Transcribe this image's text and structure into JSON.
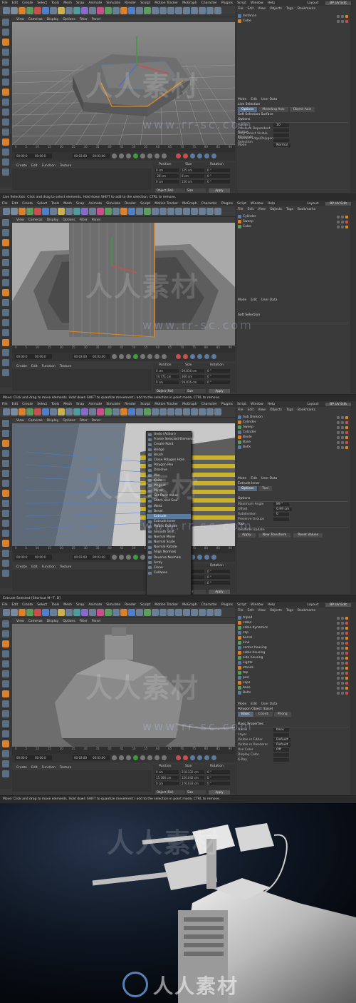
{
  "menu": [
    "File",
    "Edit",
    "Create",
    "Select",
    "Tools",
    "Mesh",
    "Snap",
    "Animate",
    "Simulate",
    "Render",
    "Sculpt",
    "Motion Tracker",
    "MoGraph",
    "Character",
    "Plugins",
    "Script",
    "Window",
    "Help"
  ],
  "layout": {
    "label": "Layout:",
    "value": "BP UV Edit"
  },
  "viewport_menu": [
    "View",
    "Cameras",
    "Display",
    "Options",
    "Filter",
    "Panel"
  ],
  "object_menu": [
    "File",
    "Edit",
    "View",
    "Objects",
    "Tags",
    "Bookmarks"
  ],
  "attr_menu": [
    "Mode",
    "Edit",
    "User Data"
  ],
  "material_menu": [
    "Create",
    "Edit",
    "Function",
    "Texture"
  ],
  "coords": {
    "position": "Position",
    "size": "Size",
    "rotation": "Rotation",
    "object_rel": "Object (Rel)",
    "size_sel": "Size",
    "apply": "Apply"
  },
  "timeline": [
    "0",
    "5",
    "10",
    "15",
    "20",
    "25",
    "30",
    "35",
    "40",
    "45",
    "50",
    "55",
    "60",
    "65",
    "70",
    "75",
    "80",
    "85",
    "90"
  ],
  "fields": {
    "start": "00:00:0",
    "cur": "00:00:0",
    "end": "00:03:00",
    "end2": "00:03:00"
  },
  "panels": [
    {
      "status": "Live Selection: Click and drag to select elements. Hold down SHIFT to add to the selection, CTRL to remove.",
      "objects": [
        "Instance",
        "Cube"
      ],
      "attr_title": "Live Selection",
      "tabs": [
        "Options",
        "Modeling Axis",
        "Object Axis"
      ],
      "sub": "Soft Selection Surface",
      "section": "Options",
      "rows": [
        [
          "Radius",
          "10"
        ],
        [
          "Pressure Dependent Radius",
          ""
        ],
        [
          "Only Select Visible Elements",
          ""
        ],
        [
          "Tolerant Edge/Polygon Selection",
          ""
        ],
        [
          "Mode",
          "Normal"
        ]
      ],
      "coord_vals": [
        [
          "0 cm",
          "125 cm",
          "0 °"
        ],
        [
          "-28 cm",
          "8 cm",
          "0 °"
        ],
        [
          "0 cm",
          "150 cm",
          "0 °"
        ]
      ]
    },
    {
      "status": "Move: Click and drag to move elements. Hold down SHIFT to quantize movement / add to the selection in point mode, CTRL to remove.",
      "objects": [
        "Cylinder",
        "Sweep",
        "Cube"
      ],
      "attr_title": "",
      "tabs": [],
      "sub": "Soft Selection",
      "section": "",
      "rows": [],
      "coord_vals": [
        [
          "0 cm",
          "59.816 cm",
          "0 °"
        ],
        [
          "74.771 cm",
          "300 cm",
          "0 °"
        ],
        [
          "0 cm",
          "59.816 cm",
          "0 °"
        ]
      ]
    },
    {
      "status": "Extrude Selected [Shortcut M~T, D]",
      "objects": [
        "Sub Division",
        "Cylinder",
        "Sweep",
        "Cylinder",
        "Boole",
        "Base",
        "Bolts"
      ],
      "attr_title": "Extrude Inner",
      "tabs": [
        "Options",
        "Tool"
      ],
      "sub": "",
      "section": "Options",
      "rows": [
        [
          "Maximum Angle",
          "89 °"
        ],
        [
          "Offset",
          "0.99 cm"
        ],
        [
          "Subdivision",
          "0"
        ],
        [
          "Preserve Groups",
          ""
        ]
      ],
      "extra": {
        "tool": "Tool",
        "realtime": "Realtime Update",
        "apply": "Apply",
        "new": "New Transform",
        "reset": "Reset Values",
        "var": "Var.",
        "pct": "0 %",
        "ngons": "Create N-gons"
      },
      "coord_vals": [
        [
          "0 cm",
          "0 cm",
          "0 °"
        ],
        [
          "0 cm",
          "0 cm",
          "0 °"
        ],
        [
          "0 cm",
          "0 cm",
          "0 °"
        ]
      ],
      "context": [
        "Undo (Action)",
        "Frame Selected Elements",
        "Create Point",
        "Bridge",
        "Brush",
        "Close Polygon Hole",
        "Polygon Pen",
        "Dissolve",
        "Iron",
        "Knife",
        "Magnet",
        "Mirror",
        "Set Point Value",
        "Stitch and Sew",
        "Weld",
        "Bevel",
        "Extrude",
        "Extrude Inner",
        "Matrix Extrude",
        "Smooth Shift",
        "Normal Move",
        "Normal Scale",
        "Normal Rotate",
        "Align Normals",
        "Reverse Normals",
        "Array",
        "Clone",
        "Collapse"
      ]
    },
    {
      "status": "Move: Click and drag to move elements. Hold down SHIFT to quantize movement / add to the selection in point mode, CTRL to remove.",
      "objects": [
        "tripod",
        "cable",
        "cable dynamics",
        "cap",
        "barrel",
        "kink",
        "center housing",
        "cable housing",
        "side housing",
        "Lights",
        "stands",
        "top",
        "pod",
        "caps",
        "base",
        "Bolts"
      ],
      "attr_title": "Polygon Object [base]",
      "tabs": [
        "Basic",
        "Coord.",
        "Phong"
      ],
      "sub": "",
      "section": "Basic Properties",
      "rows": [
        [
          "Name",
          "base"
        ],
        [
          "Layer",
          ""
        ],
        [
          "Visible in Editor",
          "Default"
        ],
        [
          "Visible in Renderer",
          "Default"
        ],
        [
          "Use Color",
          "Off"
        ],
        [
          "Display Color",
          ""
        ],
        [
          "X-Ray",
          ""
        ]
      ],
      "coord_vals": [
        [
          "0 cm",
          "218.332 cm",
          "0 °"
        ],
        [
          "15.306 cm",
          "120.042 cm",
          "0 °"
        ],
        [
          "0 cm",
          "276.033 cm",
          "0 °"
        ]
      ]
    }
  ],
  "watermark": {
    "text": "人人素材",
    "url": "www.rr-sc.com"
  },
  "colors": {
    "accent": "#5b7ba0",
    "orange": "#e08a1e",
    "bg": "#3a3a3a"
  }
}
